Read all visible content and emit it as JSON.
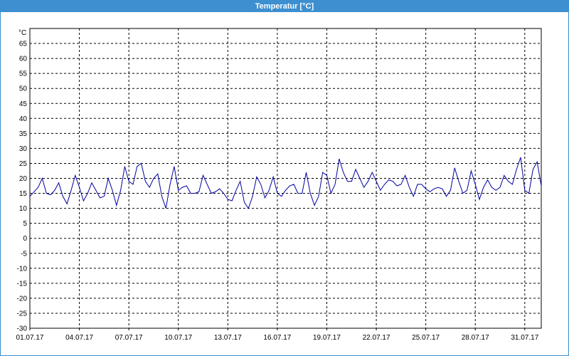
{
  "window": {
    "title": "Temperatur [°C]"
  },
  "chart_data": {
    "type": "line",
    "title": "Temperatur [°C]",
    "ylabel": "°C",
    "xlabel": "",
    "ylim": [
      -30,
      70
    ],
    "xlim": [
      "01.07.17",
      "01.08.17"
    ],
    "y_ticks": [
      -30,
      -25,
      -20,
      -15,
      -10,
      -5,
      0,
      5,
      10,
      15,
      20,
      25,
      30,
      35,
      40,
      45,
      50,
      55,
      60,
      65
    ],
    "x_ticks": [
      "01.07.17",
      "04.07.17",
      "07.07.17",
      "10.07.17",
      "13.07.17",
      "16.07.17",
      "19.07.17",
      "22.07.17",
      "25.07.17",
      "28.07.17",
      "31.07.17"
    ],
    "grid": true,
    "legend": "none",
    "series_color": "#0000a0",
    "series": [
      {
        "x": [
          "01.07.17 00:00",
          "01.07.17 06:00",
          "01.07.17 12:00",
          "01.07.17 18:00",
          "02.07.17 00:00",
          "02.07.17 06:00",
          "02.07.17 12:00",
          "02.07.17 18:00",
          "03.07.17 00:00",
          "03.07.17 06:00",
          "03.07.17 12:00",
          "03.07.17 18:00",
          "04.07.17 00:00",
          "04.07.17 06:00",
          "04.07.17 12:00",
          "04.07.17 18:00",
          "05.07.17 00:00",
          "05.07.17 06:00",
          "05.07.17 12:00",
          "05.07.17 18:00",
          "06.07.17 00:00",
          "06.07.17 06:00",
          "06.07.17 12:00",
          "06.07.17 18:00",
          "07.07.17 00:00",
          "07.07.17 06:00",
          "07.07.17 12:00",
          "07.07.17 18:00",
          "08.07.17 00:00",
          "08.07.17 06:00",
          "08.07.17 12:00",
          "08.07.17 18:00",
          "09.07.17 00:00",
          "09.07.17 06:00",
          "09.07.17 12:00",
          "09.07.17 18:00",
          "10.07.17 00:00",
          "10.07.17 06:00",
          "10.07.17 12:00",
          "10.07.17 18:00",
          "11.07.17 00:00",
          "11.07.17 06:00",
          "11.07.17 12:00",
          "11.07.17 18:00",
          "12.07.17 00:00",
          "12.07.17 06:00",
          "12.07.17 12:00",
          "12.07.17 18:00",
          "13.07.17 00:00",
          "13.07.17 06:00",
          "13.07.17 12:00",
          "13.07.17 18:00",
          "14.07.17 00:00",
          "14.07.17 06:00",
          "14.07.17 12:00",
          "14.07.17 18:00",
          "15.07.17 00:00",
          "15.07.17 06:00",
          "15.07.17 12:00",
          "15.07.17 18:00",
          "16.07.17 00:00",
          "16.07.17 06:00",
          "16.07.17 12:00",
          "16.07.17 18:00",
          "17.07.17 00:00",
          "17.07.17 06:00",
          "17.07.17 12:00",
          "17.07.17 18:00",
          "18.07.17 00:00",
          "18.07.17 06:00",
          "18.07.17 12:00",
          "18.07.17 18:00",
          "19.07.17 00:00",
          "19.07.17 06:00",
          "19.07.17 12:00",
          "19.07.17 18:00",
          "20.07.17 00:00",
          "20.07.17 06:00",
          "20.07.17 12:00",
          "20.07.17 18:00",
          "21.07.17 00:00",
          "21.07.17 06:00",
          "21.07.17 12:00",
          "21.07.17 18:00",
          "22.07.17 00:00",
          "22.07.17 06:00",
          "22.07.17 12:00",
          "22.07.17 18:00",
          "23.07.17 00:00",
          "23.07.17 06:00",
          "23.07.17 12:00",
          "23.07.17 18:00",
          "24.07.17 00:00",
          "24.07.17 06:00",
          "24.07.17 12:00",
          "24.07.17 18:00",
          "25.07.17 00:00",
          "25.07.17 06:00",
          "25.07.17 12:00",
          "25.07.17 18:00",
          "26.07.17 00:00",
          "26.07.17 06:00",
          "26.07.17 12:00",
          "26.07.17 18:00",
          "27.07.17 00:00",
          "27.07.17 06:00",
          "27.07.17 12:00",
          "27.07.17 18:00",
          "28.07.17 00:00",
          "28.07.17 06:00",
          "28.07.17 12:00",
          "28.07.17 18:00",
          "29.07.17 00:00",
          "29.07.17 06:00",
          "29.07.17 12:00",
          "29.07.17 18:00",
          "30.07.17 00:00",
          "30.07.17 06:00",
          "30.07.17 12:00",
          "30.07.17 18:00",
          "31.07.17 00:00",
          "31.07.17 06:00",
          "31.07.17 12:00",
          "31.07.17 18:00",
          "01.08.17 00:00"
        ],
        "values": [
          14,
          15.5,
          17,
          20,
          15,
          14.5,
          16,
          18.5,
          14,
          11.5,
          16,
          21,
          17,
          12.5,
          15,
          18.5,
          16,
          13.5,
          14,
          20,
          16,
          11,
          16,
          24,
          19,
          18,
          24,
          25,
          19,
          17,
          20,
          21.5,
          14,
          10,
          18,
          24,
          16,
          17,
          17.5,
          15,
          15,
          15.5,
          21,
          18,
          15,
          15.5,
          16.5,
          15,
          13,
          12.5,
          16,
          19,
          12,
          10,
          14,
          20.5,
          18,
          13.5,
          16,
          20.5,
          15,
          14,
          16,
          17.5,
          18,
          15,
          15,
          22,
          15,
          11,
          14,
          22,
          21,
          15,
          18,
          26.5,
          22,
          19,
          19,
          23,
          20,
          17,
          19,
          22,
          19,
          16,
          18,
          19.5,
          19,
          17.5,
          18,
          21,
          17,
          14,
          18,
          18,
          16.5,
          15.5,
          16.5,
          17,
          16.5,
          14,
          16,
          23.5,
          19,
          15,
          16,
          22.5,
          18,
          13,
          17,
          19.5,
          17,
          16,
          17,
          21,
          19,
          18,
          23,
          27,
          16,
          15,
          23,
          25.5,
          17.5
        ]
      }
    ]
  }
}
